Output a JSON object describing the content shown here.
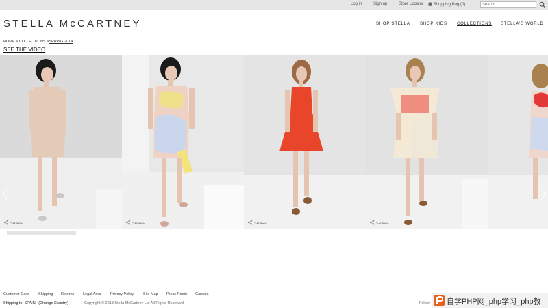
{
  "topbar": {
    "login": "Log in",
    "signup": "Sign up",
    "store_locator": "Store Locator",
    "shopping_bag": "Shopping Bag (0)",
    "search_placeholder": "Search"
  },
  "logo": "STELLA McCARTNEY",
  "nav": {
    "shop_stella": "SHOP STELLA",
    "shop_kids": "SHOP KIDS",
    "collections": "COLLECTIONS",
    "stellas_world": "STELLA'S WORLD"
  },
  "breadcrumb": {
    "home": "HOME",
    "sep1": " > ",
    "collections": "COLLECTIONS",
    "sep2": " >",
    "current": "SPRING 2014"
  },
  "see_video": "SEE THE VIDEO",
  "gallery": {
    "share_label": "SHARE",
    "looks": [
      {
        "name": "look-1",
        "dress_color": "#e3cbb8",
        "top_color": "#e3cbb8",
        "skirt_color": "#e3cbb8",
        "bg": "#dcdcdc"
      },
      {
        "name": "look-2",
        "dress_color": "#f0d2c4",
        "top_color": "#efe08a",
        "skirt_color": "#c9d6ec",
        "bg": "#e8e8e8"
      },
      {
        "name": "look-3",
        "dress_color": "#e8452a",
        "top_color": "#e8452a",
        "skirt_color": "#e8452a",
        "bg": "#e4e4e4"
      },
      {
        "name": "look-4",
        "dress_color": "#f3e9d4",
        "top_color": "#ef8d80",
        "skirt_color": "#efe7d7",
        "bg": "#e2e2e2"
      },
      {
        "name": "look-5",
        "dress_color": "#f0d7cb",
        "top_color": "#e23a38",
        "skirt_color": "#cfd9ee",
        "bg": "#e6e6e6"
      }
    ]
  },
  "footer": {
    "links": [
      "Customer Care",
      "Shipping",
      "Returns",
      "Legal Area",
      "Privacy Policy",
      "Site Map",
      "Press Room",
      "Careers"
    ],
    "shipping_to": "Shipping to: SPAIN",
    "change_country": "(Change Country)",
    "copyright": "Copyright © 2013 Stella McCartney Ltd All Rights Reserved",
    "follow": "Follow"
  },
  "watermark": {
    "text": "自学PHP网_php学习_php教"
  },
  "colors": {
    "topbar_bg": "#e6e6e6",
    "watermark_logo": "#e8611a"
  }
}
